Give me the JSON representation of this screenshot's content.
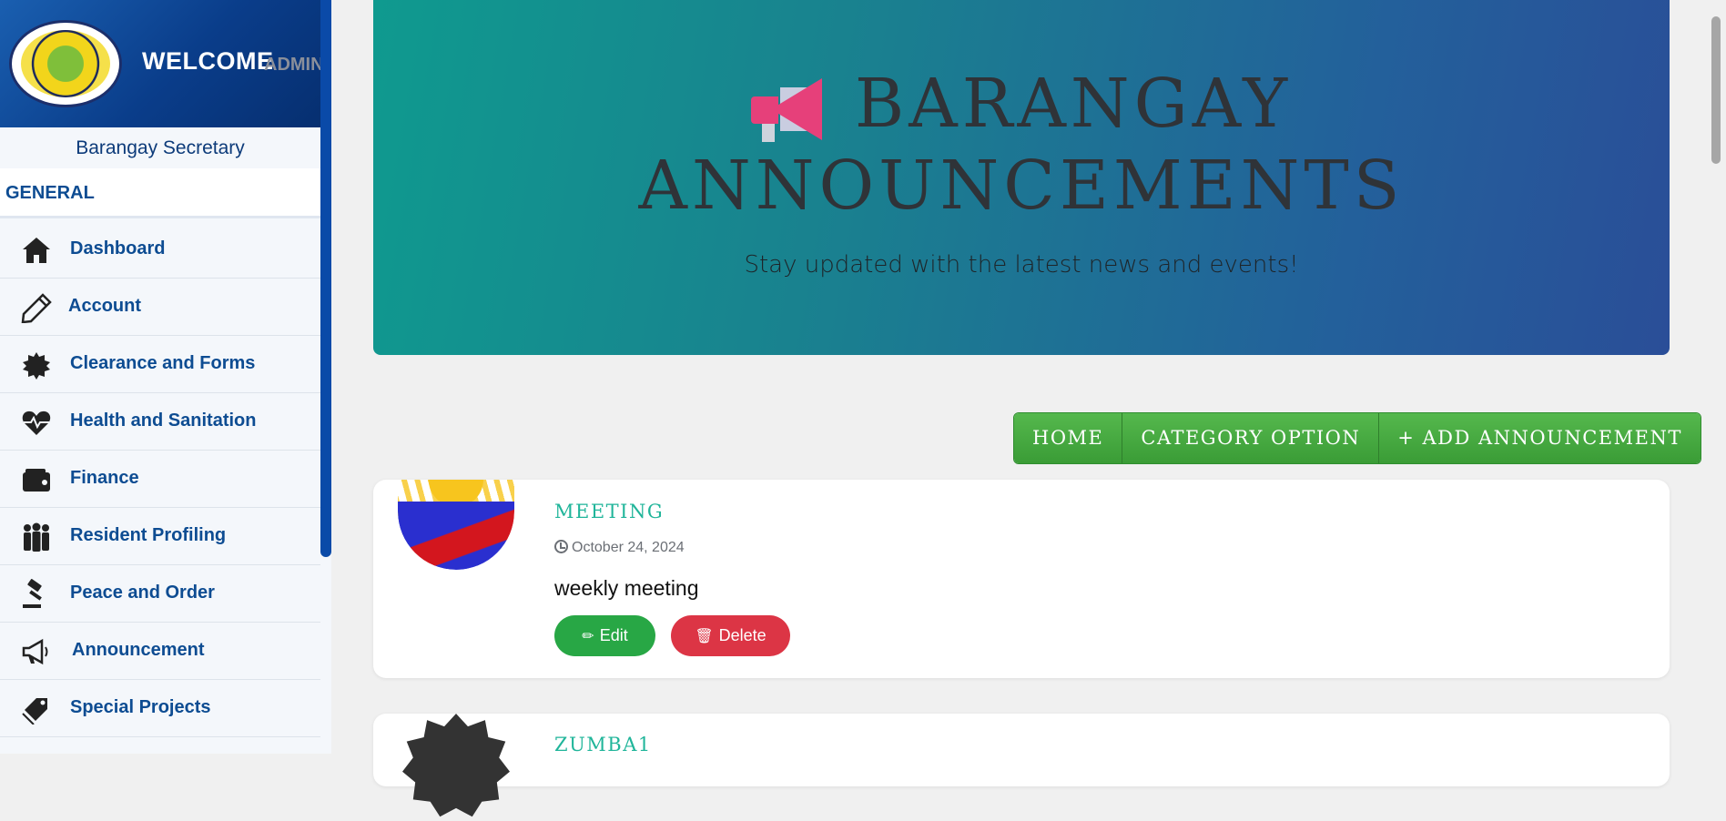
{
  "sidebar": {
    "welcome": "WELCOME",
    "welcome_suffix": "ADMIN",
    "role": "Barangay Secretary",
    "section": "GENERAL",
    "items": [
      {
        "label": "Dashboard",
        "icon": "home-icon"
      },
      {
        "label": "Account",
        "icon": "pencil-icon"
      },
      {
        "label": "Clearance and Forms",
        "icon": "badge-icon"
      },
      {
        "label": "Health and Sanitation",
        "icon": "heart-pulse-icon"
      },
      {
        "label": "Finance",
        "icon": "wallet-icon"
      },
      {
        "label": "Resident Profiling",
        "icon": "users-icon"
      },
      {
        "label": "Peace and Order",
        "icon": "gavel-icon"
      },
      {
        "label": "Announcement",
        "icon": "megaphone-icon"
      },
      {
        "label": "Special Projects",
        "icon": "tags-icon"
      }
    ]
  },
  "hero": {
    "title_line1": "BARANGAY",
    "title_line2": "ANNOUNCEMENTS",
    "subtitle": "Stay updated with the latest news and events!"
  },
  "toolbar": {
    "home": "HOME",
    "category": "CATEGORY OPTION",
    "add": "+ ADD ANNOUNCEMENT"
  },
  "announcements": [
    {
      "title": "MEETING",
      "date": "October 24, 2024",
      "description": "weekly meeting",
      "edit_label": "Edit",
      "delete_label": "Delete"
    },
    {
      "title": "ZUMBA1"
    }
  ],
  "colors": {
    "sidebar_header": "#0a3d8a",
    "accent_teal": "#20b59a",
    "edit_green": "#28a745",
    "delete_red": "#dc3545",
    "toolbar_green": "#3a9c36"
  }
}
